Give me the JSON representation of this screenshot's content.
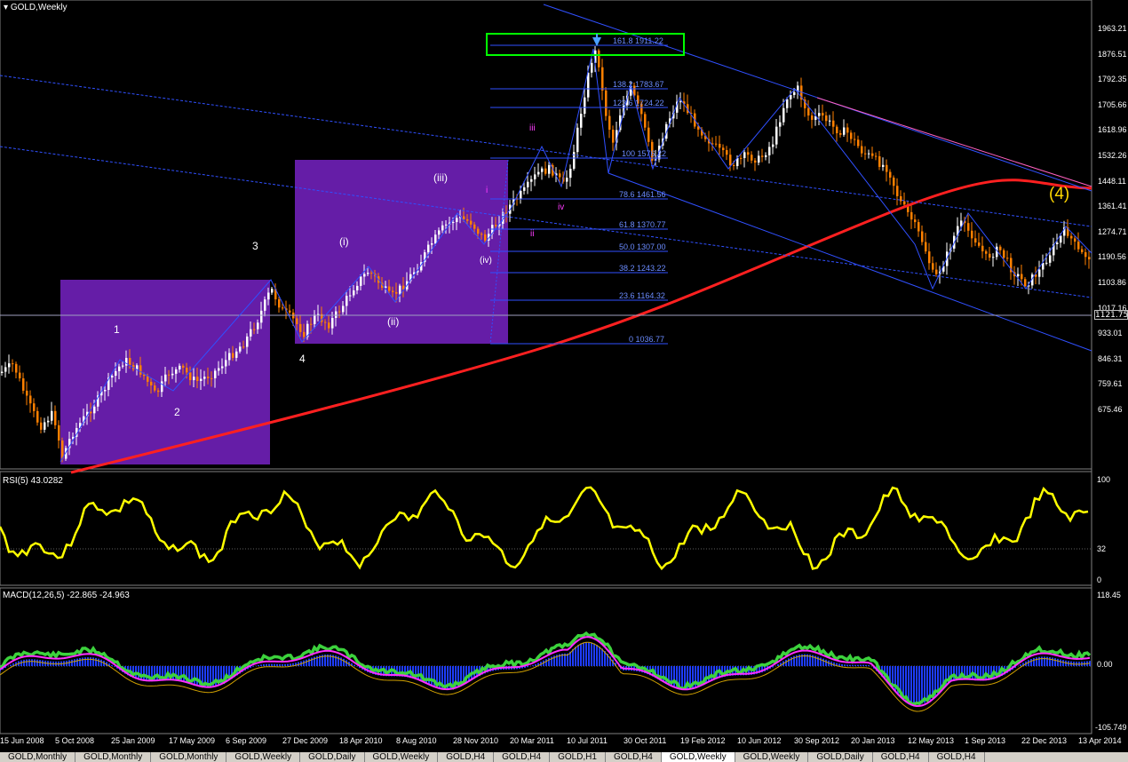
{
  "window": {
    "title": "GOLD,Weekly"
  },
  "indicators": {
    "rsi_label": "RSI(5) 43.0282",
    "rsi_levels": [
      "100",
      "32",
      "0"
    ],
    "macd_label": "MACD(12,26,5) -22.865 -24.963",
    "macd_levels": [
      "118.45",
      "0.00",
      "-105.749"
    ]
  },
  "price_axis": [
    "1963.21",
    "1876.51",
    "1792.35",
    "1705.66",
    "1618.96",
    "1532.26",
    "1448.11",
    "1361.41",
    "1274.71",
    "1190.56",
    "1103.86",
    "1017.16",
    "933.01",
    "846.31",
    "759.61",
    "675.46"
  ],
  "current_price": "1121.75",
  "fib_levels": [
    "161.8 1911.22",
    "138.2 1783.67",
    "123.6 1724.22",
    "100 1576.22",
    "78.6 1461.56",
    "61.8 1370.77",
    "50.0 1307.00",
    "38.2 1243.22",
    "23.6 1164.32",
    "0 1036.77"
  ],
  "wave_labels": {
    "w1": "1",
    "w2": "2",
    "w3": "3",
    "w4": "4",
    "wi": "(i)",
    "wii": "(ii)",
    "wiii": "(iii)",
    "wiv": "(iv)",
    "si": "i",
    "sii": "ii",
    "siii": "iii",
    "siv": "iv",
    "big4": "(4)"
  },
  "date_axis": [
    "15 Jun 2008",
    "5 Oct 2008",
    "25 Jan 2009",
    "17 May 2009",
    "6 Sep 2009",
    "27 Dec 2009",
    "18 Apr 2010",
    "8 Aug 2010",
    "28 Nov 2010",
    "20 Mar 2011",
    "10 Jul 2011",
    "30 Oct 2011",
    "19 Feb 2012",
    "10 Jun 2012",
    "30 Sep 2012",
    "20 Jan 2013",
    "12 May 2013",
    "1 Sep 2013",
    "22 Dec 2013",
    "13 Apr 2014"
  ],
  "tabs": [
    "GOLD,Monthly",
    "GOLD,Monthly",
    "GOLD,Monthly",
    "GOLD,Weekly",
    "GOLD,Daily",
    "GOLD,Weekly",
    "GOLD,H4",
    "GOLD,H4",
    "GOLD,H1",
    "GOLD,H4",
    "GOLD,Weekly",
    "GOLD,Weekly",
    "GOLD,Daily",
    "GOLD,H4",
    "GOLD,H4"
  ],
  "active_tab_index": 10,
  "colors": {
    "bull": "#ffffff",
    "bear": "#ff8000",
    "sma": "#ff2020",
    "rsi": "#ffff00",
    "macd_fast": "#3cd23c",
    "macd_signal": "#ff30ff",
    "macd_hist": "#1e3cff",
    "box": "#6a1fb0",
    "fib": "#3050ff",
    "channel": "#3050ff",
    "highlight": "#00ff00"
  }
}
